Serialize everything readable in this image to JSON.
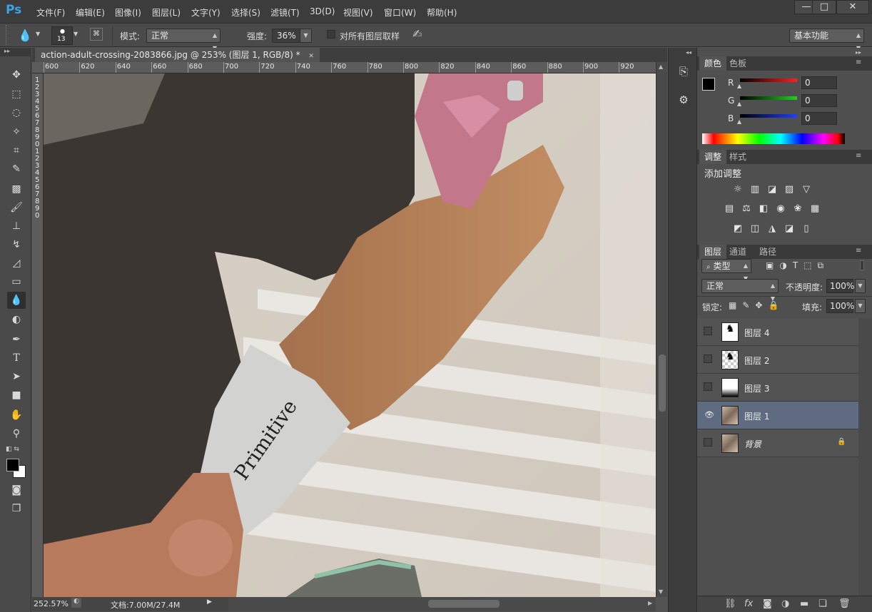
{
  "app": {
    "logo": "Ps",
    "menu": [
      "文件(F)",
      "编辑(E)",
      "图像(I)",
      "图层(L)",
      "文字(Y)",
      "选择(S)",
      "滤镜(T)",
      "3D(D)",
      "视图(V)",
      "窗口(W)",
      "帮助(H)"
    ],
    "window_controls": {
      "minimize": "—",
      "maximize": "□",
      "close": "✕"
    }
  },
  "options": {
    "brush_size": "13",
    "mode_label": "模式:",
    "mode_value": "正常",
    "strength_label": "强度:",
    "strength_value": "36%",
    "sample_all_label": "对所有图层取样",
    "workspace": "基本功能"
  },
  "document": {
    "tab_title": "action-adult-crossing-2083866.jpg @ 253% (图层 1, RGB/8) *",
    "close": "✕",
    "ruler_top": [
      "600",
      "620",
      "640",
      "660",
      "680",
      "700",
      "720",
      "740",
      "760",
      "780",
      "800",
      "820",
      "840",
      "860",
      "880",
      "900",
      "920"
    ],
    "ruler_left": [
      "1",
      "2",
      "3",
      "4",
      "5",
      "6",
      "7",
      "8",
      "9",
      "0",
      "1",
      "2",
      "3",
      "4",
      "5",
      "6",
      "7",
      "8",
      "9",
      "0"
    ]
  },
  "status": {
    "zoom": "252.57%",
    "doc_info": "文档:7.00M/27.4M"
  },
  "color_panel": {
    "tabs": [
      "颜色",
      "色板"
    ],
    "channels": [
      {
        "label": "R",
        "value": "0",
        "color": "#ff2020"
      },
      {
        "label": "G",
        "value": "0",
        "color": "#20d020"
      },
      {
        "label": "B",
        "value": "0",
        "color": "#2040ff"
      }
    ]
  },
  "adjust_panel": {
    "tabs": [
      "调整",
      "样式"
    ],
    "title": "添加调整",
    "row1": [
      "☼",
      "▥",
      "◪",
      "▨",
      "▽"
    ],
    "row2": [
      "▤",
      "⚖",
      "◧",
      "◉",
      "❀",
      "▦"
    ],
    "row3": [
      "◩",
      "◫",
      "◮",
      "◪",
      "▯"
    ]
  },
  "layers_panel": {
    "tabs": [
      "图层",
      "通道",
      "路径"
    ],
    "filter_label": "类型",
    "blend_mode": "正常",
    "opacity_label": "不透明度:",
    "opacity_value": "100%",
    "lock_label": "锁定:",
    "fill_label": "填充:",
    "fill_value": "100%",
    "layers": [
      {
        "name": "图层 4",
        "visible": false,
        "selected": false
      },
      {
        "name": "图层 2",
        "visible": false,
        "selected": false
      },
      {
        "name": "图层 3",
        "visible": false,
        "selected": false
      },
      {
        "name": "图层 1",
        "visible": true,
        "selected": true
      },
      {
        "name": "背景",
        "visible": false,
        "selected": false,
        "locked": true
      }
    ],
    "footer_icons": [
      "link-icon",
      "fx-icon",
      "mask-icon",
      "adjustment-icon",
      "folder-icon",
      "new-layer-icon",
      "trash-icon"
    ]
  }
}
